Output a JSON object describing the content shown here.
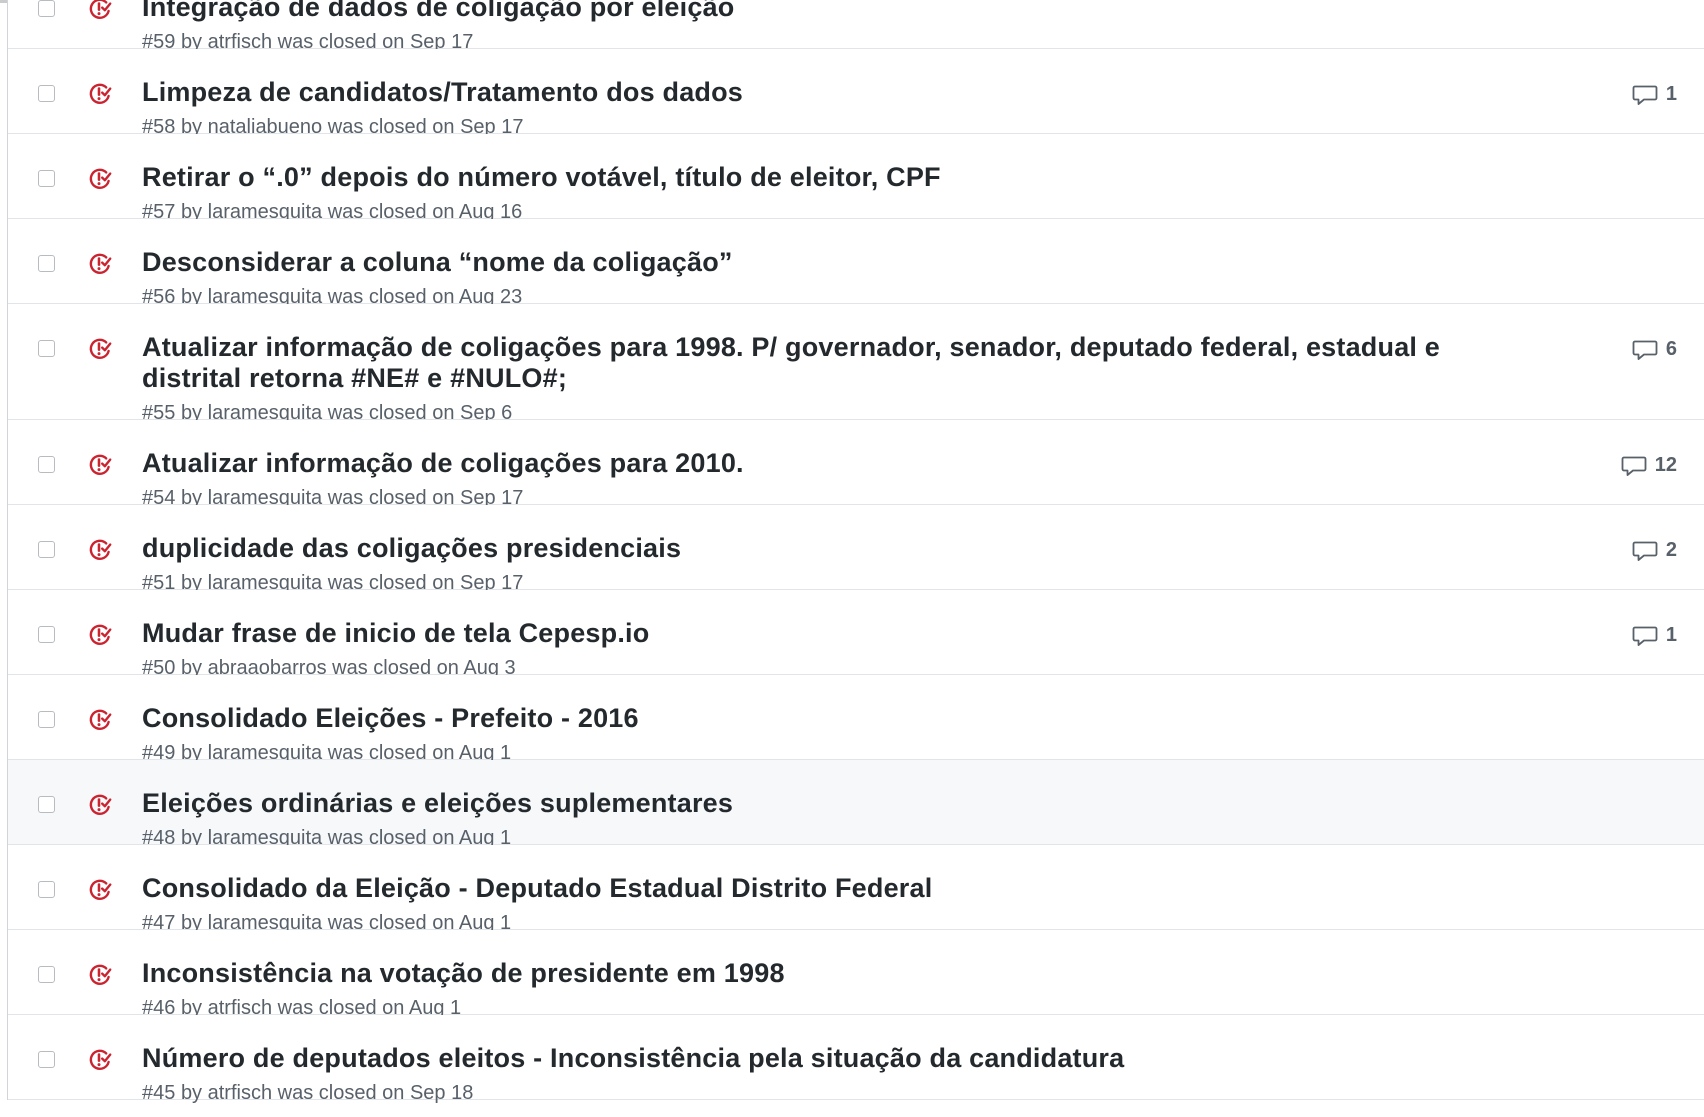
{
  "issues": [
    {
      "title": "Integração de dados de coligação por eleição",
      "number": "#59",
      "by": "by",
      "author": "atrfisch",
      "closed_text": "was closed on",
      "date": "Sep 17",
      "comments": "",
      "partial": true
    },
    {
      "title": "Limpeza de candidatos/Tratamento dos dados",
      "number": "#58",
      "by": "by",
      "author": "nataliabueno",
      "closed_text": "was closed on",
      "date": "Sep 17",
      "comments": "1"
    },
    {
      "title": "Retirar o “.0” depois do número votável, título de eleitor, CPF",
      "number": "#57",
      "by": "by",
      "author": "laramesquita",
      "closed_text": "was closed on",
      "date": "Aug 16",
      "comments": ""
    },
    {
      "title": "Desconsiderar a coluna “nome da coligação”",
      "number": "#56",
      "by": "by",
      "author": "laramesquita",
      "closed_text": "was closed on",
      "date": "Aug 23",
      "comments": ""
    },
    {
      "title": "Atualizar informação de coligações para 1998. P/ governador, senador, deputado federal, estadual e distrital retorna #NE# e #NULO#;",
      "number": "#55",
      "by": "by",
      "author": "laramesquita",
      "closed_text": "was closed on",
      "date": "Sep 6",
      "comments": "6",
      "tall": true
    },
    {
      "title": "Atualizar informação de coligações para 2010.",
      "number": "#54",
      "by": "by",
      "author": "laramesquita",
      "closed_text": "was closed on",
      "date": "Sep 17",
      "comments": "12"
    },
    {
      "title": "duplicidade das coligações presidenciais",
      "number": "#51",
      "by": "by",
      "author": "laramesquita",
      "closed_text": "was closed on",
      "date": "Sep 17",
      "comments": "2"
    },
    {
      "title": "Mudar frase de inicio de tela Cepesp.io",
      "number": "#50",
      "by": "by",
      "author": "abraaobarros",
      "closed_text": "was closed on",
      "date": "Aug 3",
      "comments": "1"
    },
    {
      "title": "Consolidado Eleições - Prefeito - 2016",
      "number": "#49",
      "by": "by",
      "author": "laramesquita",
      "closed_text": "was closed on",
      "date": "Aug 1",
      "comments": ""
    },
    {
      "title": "Eleições ordinárias e eleições suplementares",
      "number": "#48",
      "by": "by",
      "author": "laramesquita",
      "closed_text": "was closed on",
      "date": "Aug 1",
      "comments": "",
      "highlight": true
    },
    {
      "title": "Consolidado da Eleição - Deputado Estadual Distrito Federal",
      "number": "#47",
      "by": "by",
      "author": "laramesquita",
      "closed_text": "was closed on",
      "date": "Aug 1",
      "comments": ""
    },
    {
      "title": "Inconsistência na votação de presidente em 1998",
      "number": "#46",
      "by": "by",
      "author": "atrfisch",
      "closed_text": "was closed on",
      "date": "Aug 1",
      "comments": ""
    },
    {
      "title": "Número de deputados eleitos - Inconsistência pela situação da candidatura",
      "number": "#45",
      "by": "by",
      "author": "atrfisch",
      "closed_text": "was closed on",
      "date": "Sep 18",
      "comments": ""
    }
  ],
  "colors": {
    "closed_icon": "#cb2431",
    "meta_text": "#586069",
    "title_text": "#24292e",
    "row_highlight": "#f6f8fa"
  },
  "icons": {
    "status": "issue-closed-icon",
    "comments": "comment-icon"
  }
}
